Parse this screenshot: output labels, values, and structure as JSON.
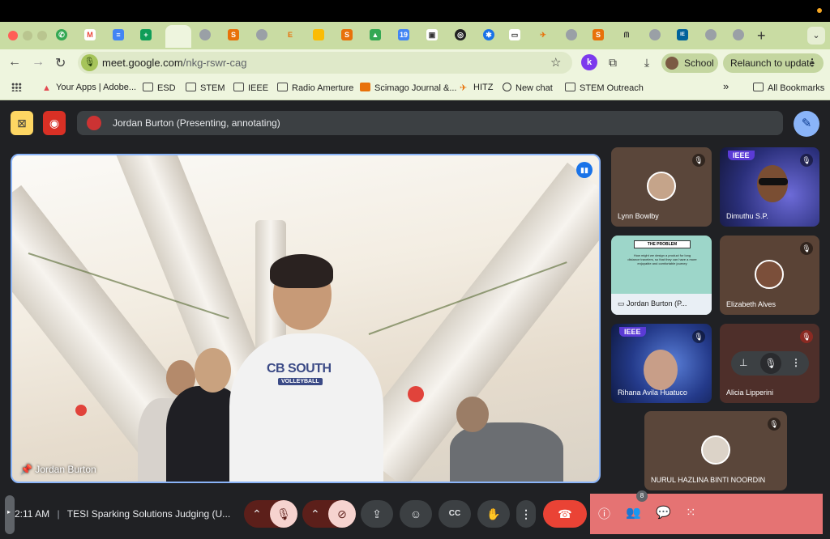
{
  "browser": {
    "url_host": "meet.google.com",
    "url_path": "/nkg-rswr-cag",
    "profile_label": "School",
    "relaunch_label": "Relaunch to update",
    "bookmarks": [
      "Your Apps | Adobe...",
      "ESD",
      "STEM",
      "IEEE",
      "Radio Amerture",
      "Scimago Journal &...",
      "HITZ",
      "New chat",
      "STEM Outreach"
    ],
    "all_bookmarks_label": "All Bookmarks",
    "overflow_label": "»"
  },
  "meet": {
    "presenting_text": "Jordan Burton (Presenting, annotating)",
    "main_speaker": "Jordan Burton",
    "shirt_line1": "CB SOUTH",
    "shirt_line2": "VOLLEYBALL",
    "participants": [
      {
        "name": "Lynn Bowlby",
        "muted": true
      },
      {
        "name": "Dimuthu S.P.",
        "muted": true,
        "tag": "IEEE"
      },
      {
        "name": "Jordan Burton (P...",
        "muted": false,
        "slide_title": "THE PROBLEM",
        "slide_text": "How might we design a product for long distance travelers, so that they can have a more enjoyable and comfortable journey"
      },
      {
        "name": "Elizabeth Alves",
        "muted": true
      },
      {
        "name": "Rihana Avila Huatuco",
        "muted": true,
        "tag": "IEEE"
      },
      {
        "name": "Alicia Lipperini",
        "muted": true
      },
      {
        "name": "NURUL HAZLINA BINTI NOORDIN",
        "muted": true
      }
    ],
    "time": "2:11 AM",
    "separator": "|",
    "meeting_title": "TESI Sparking Solutions Judging (U...",
    "people_count": "8"
  },
  "colors": {
    "tab_strip": "#c9dca3",
    "toolbar": "#eef5de",
    "meet_bg": "#202124",
    "end_call": "#ea4335",
    "active_outline": "#8ab4f8",
    "right_panel": "#e57373"
  }
}
